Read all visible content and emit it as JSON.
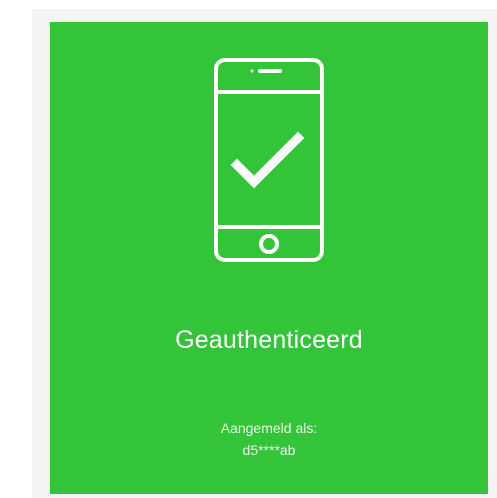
{
  "status": {
    "icon": "phone-check-icon",
    "title": "Geauthenticeerd",
    "logged_in_label": "Aangemeld als:",
    "user": "d5****ab"
  },
  "colors": {
    "card_background": "#33c43a",
    "frame_background": "#f4f4f4",
    "text": "#ffffff"
  }
}
